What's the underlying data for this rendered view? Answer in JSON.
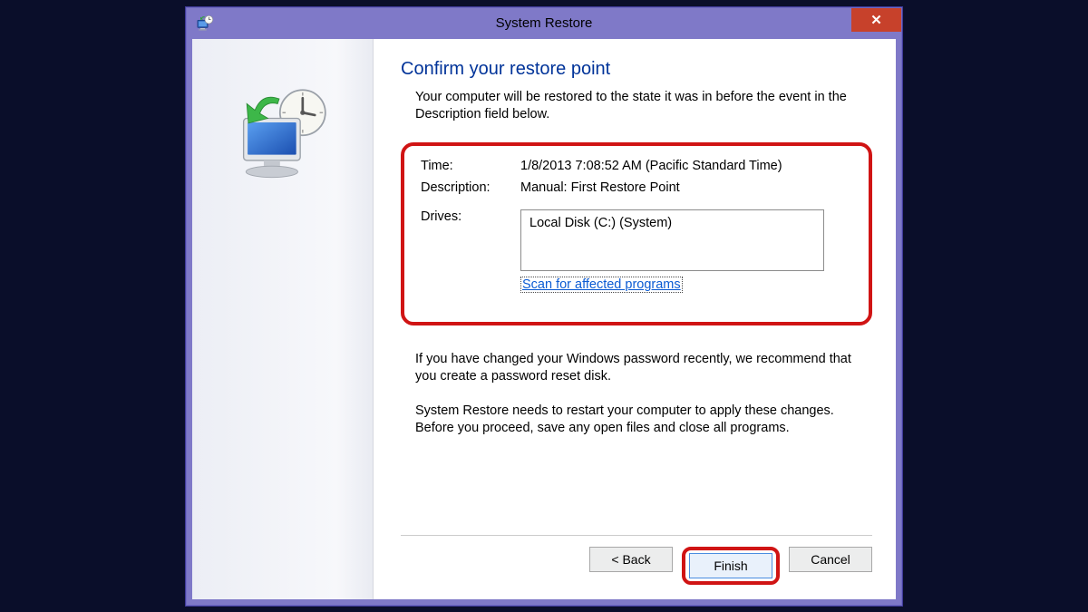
{
  "window": {
    "title": "System Restore",
    "close_symbol": "✕"
  },
  "page": {
    "heading": "Confirm your restore point",
    "intro": "Your computer will be restored to the state it was in before the event in the Description field below.",
    "fields": {
      "time_label": "Time:",
      "time_value": "1/8/2013 7:08:52 AM (Pacific Standard Time)",
      "description_label": "Description:",
      "description_value": "Manual: First Restore Point",
      "drives_label": "Drives:",
      "drives_value": "Local Disk (C:) (System)"
    },
    "scan_link": "Scan for affected programs",
    "note1": "If you have changed your Windows password recently, we recommend that you create a password reset disk.",
    "note2": "System Restore needs to restart your computer to apply these changes. Before you proceed, save any open files and close all programs."
  },
  "buttons": {
    "back": "< Back",
    "finish": "Finish",
    "cancel": "Cancel"
  }
}
